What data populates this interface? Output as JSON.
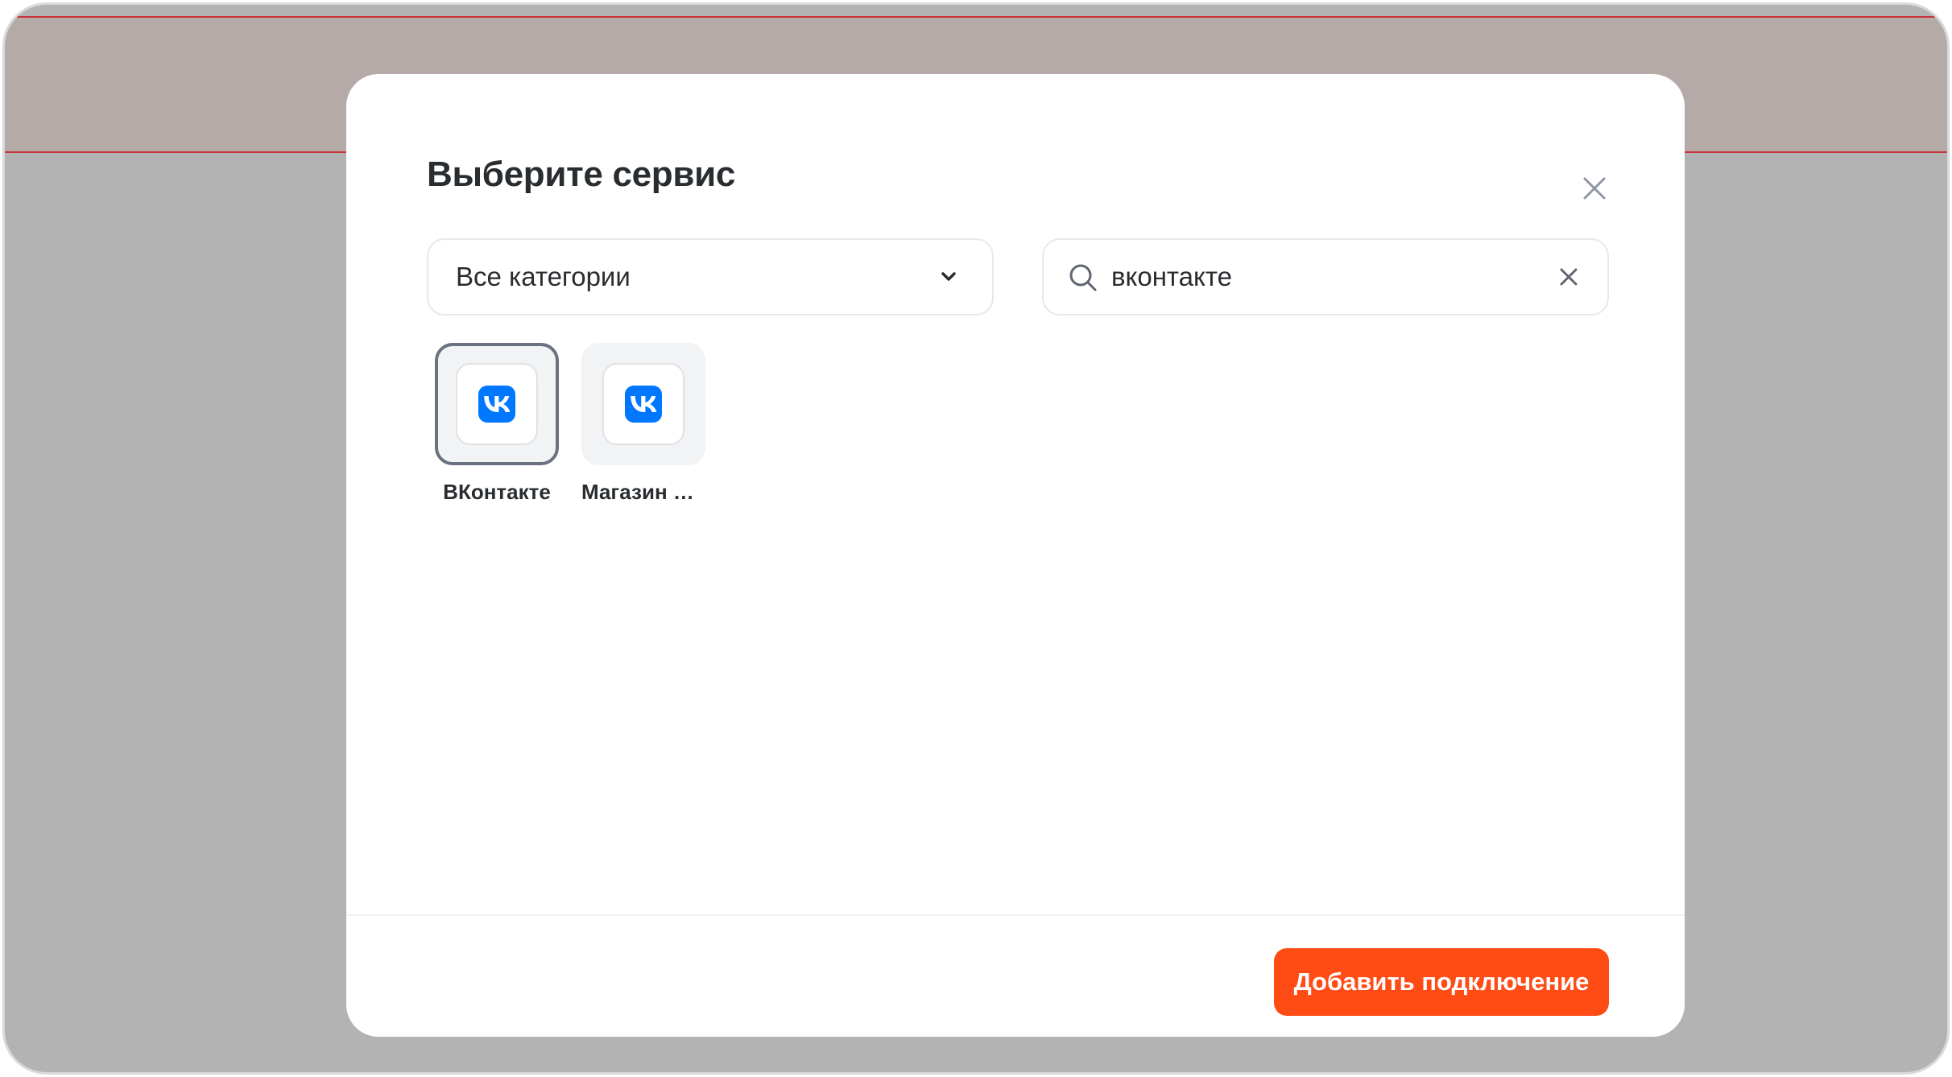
{
  "modal": {
    "title": "Выберите сервис",
    "close_icon": "close-icon"
  },
  "category_select": {
    "selected": "Все категории",
    "icon": "chevron-down-icon"
  },
  "search": {
    "value": "вконтакте",
    "icon": "search-icon",
    "clear_icon": "close-icon"
  },
  "services": [
    {
      "name": "ВКонтакте",
      "icon": "vk-logo-icon",
      "selected": true
    },
    {
      "name": "Магазин В...",
      "icon": "vk-logo-icon",
      "selected": false
    }
  ],
  "footer": {
    "add_button_label": "Добавить подключение"
  },
  "colors": {
    "accent": "#ff4b14",
    "vk_blue": "#0077ff",
    "backdrop": "#b3b3b3",
    "header_line": "#c9333a"
  }
}
